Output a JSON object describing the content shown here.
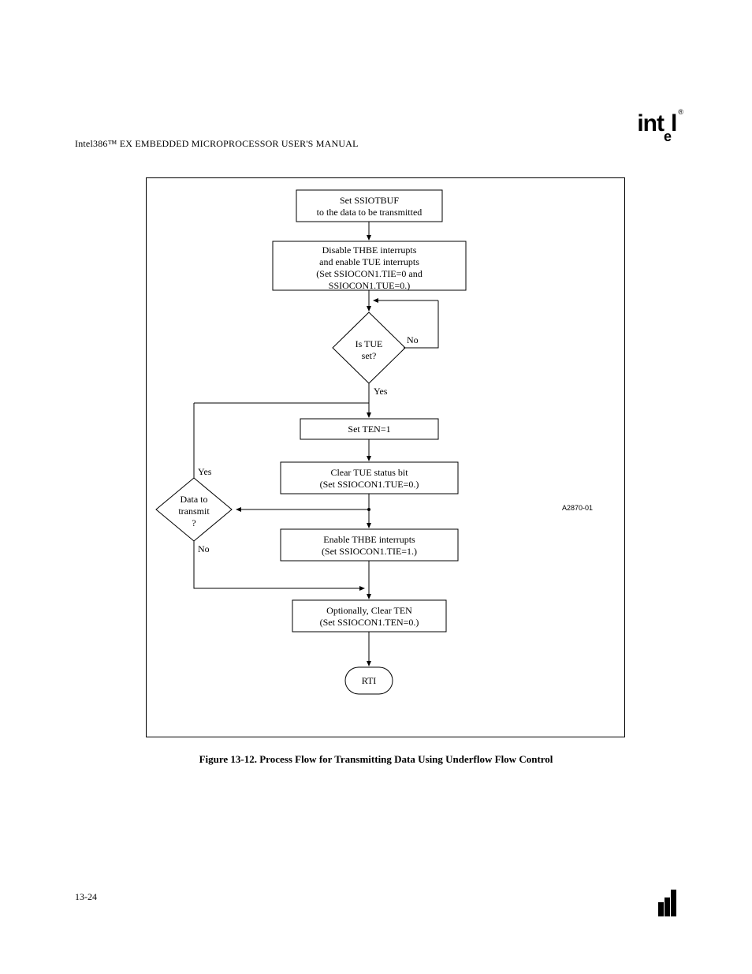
{
  "header": {
    "section": "Intel386™ EX EMBEDDED MICROPROCESSOR USER'S MANUAL"
  },
  "logo": {
    "brand": "int",
    "sub": "e",
    "tail": "l",
    "reg": "®"
  },
  "flow": {
    "n1": "Set SSIOTBUF\nto the data to be transmitted",
    "n2": "Disable THBE interrupts\nand enable TUE interrupts\n(Set SSIOCON1.TIE=0 and\nSSIOCON1.TUE=0.)",
    "d1": "Is TUE\nset?",
    "d1_yes": "Yes",
    "d1_no": "No",
    "n3": "Set TEN=1",
    "n4": "Clear TUE status bit\n(Set SSIOCON1.TUE=0.)",
    "d2": "Data to\ntransmit\n?",
    "d2_yes": "Yes",
    "d2_no": "No",
    "n5": "Enable THBE interrupts\n(Set SSIOCON1.TIE=1.)",
    "n6": "Optionally, Clear TEN\n(Set SSIOCON1.TEN=0.)",
    "end": "RTI"
  },
  "caption": "Figure 13-12. Process Flow for Transmitting Data Using Underflow Flow Control",
  "ref": "A2870-01",
  "footer": {
    "page": "13-24"
  }
}
